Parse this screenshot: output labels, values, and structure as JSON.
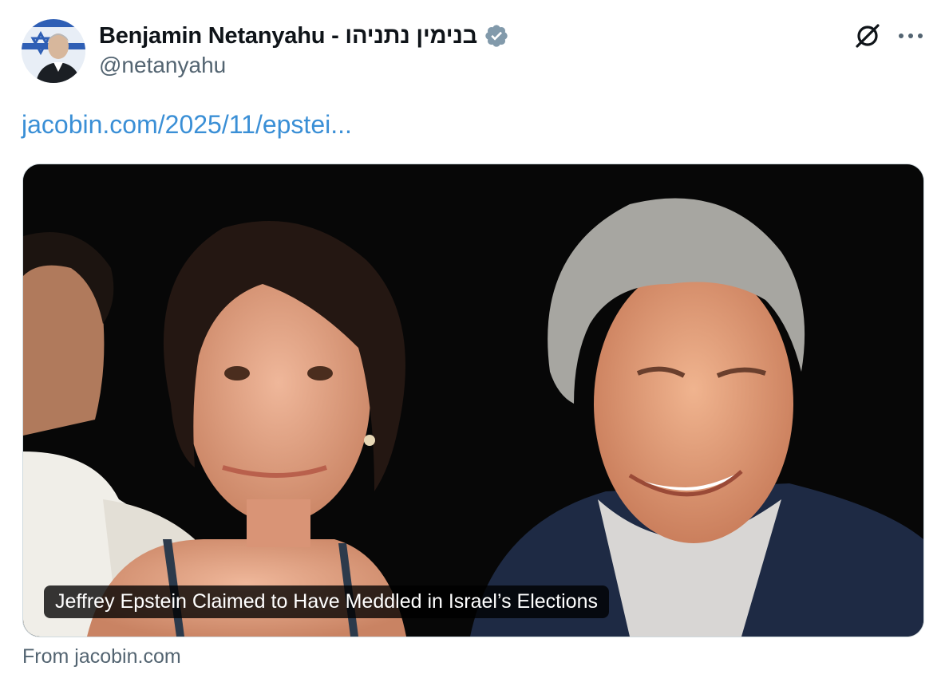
{
  "author": {
    "display_name": "Benjamin Netanyahu - בנימין נתניהו",
    "handle": "@netanyahu",
    "verified": true,
    "avatar_icon": "profile-photo-flag-background"
  },
  "actions": {
    "grok_icon": "slashed-circle-icon",
    "more_icon": "more-horizontal-icon"
  },
  "tweet": {
    "link_text": "jacobin.com/2025/11/epstei..."
  },
  "card": {
    "title": "Jeffrey Epstein Claimed to Have Meddled in Israel’s Elections",
    "source": "From jacobin.com",
    "image_description_icon": "article-photo"
  },
  "colors": {
    "link": "#3a8fd6",
    "secondary_text": "#536471",
    "verified_badge": "#829aab"
  }
}
